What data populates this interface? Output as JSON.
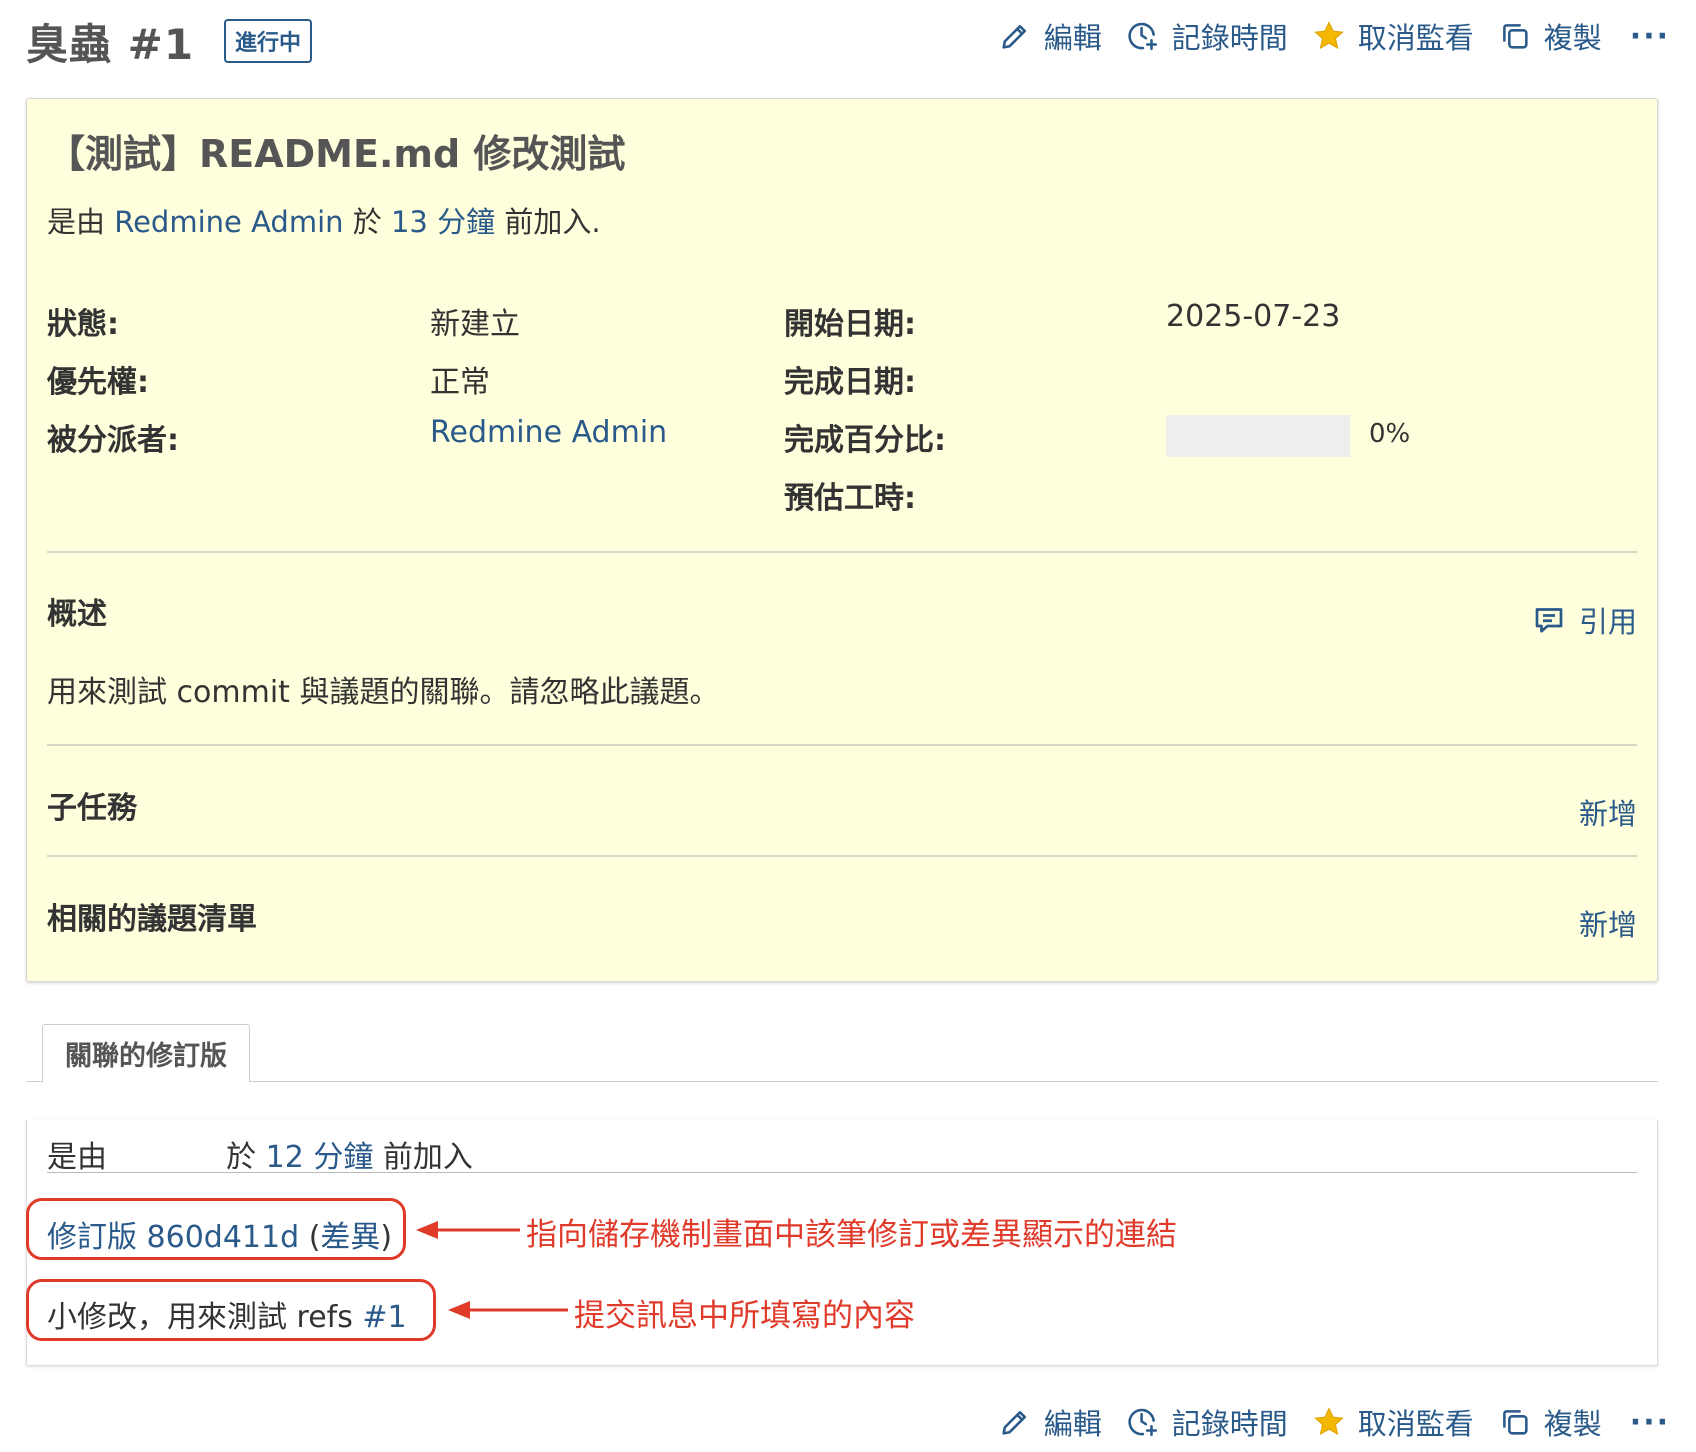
{
  "header": {
    "title": "臭蟲 #1",
    "status_badge": "進行中"
  },
  "actions": {
    "edit": "編輯",
    "log_time": "記錄時間",
    "unwatch": "取消監看",
    "copy": "複製",
    "more": "···"
  },
  "issue": {
    "subject": "【測試】README.md 修改測試",
    "author": {
      "prefix": "是由",
      "user": "Redmine Admin",
      "mid": "於",
      "time": "13 分鐘",
      "suffix": "前加入."
    },
    "attributes": {
      "status_label": "狀態:",
      "status_value": "新建立",
      "priority_label": "優先權:",
      "priority_value": "正常",
      "assignee_label": "被分派者:",
      "assignee_value": "Redmine Admin",
      "start_date_label": "開始日期:",
      "start_date_value": "2025-07-23",
      "due_date_label": "完成日期:",
      "done_ratio_label": "完成百分比:",
      "done_ratio_value": "0%",
      "done_ratio": 0,
      "estimated_hours_label": "預估工時:"
    },
    "description": {
      "title": "概述",
      "quote": "引用",
      "text": "用來測試 commit 與議題的關聯。請忽略此議題。"
    },
    "subtasks": {
      "title": "子任務",
      "add": "新增"
    },
    "relations": {
      "title": "相關的議題清單",
      "add": "新增"
    }
  },
  "tabs": {
    "revisions": "關聯的修訂版"
  },
  "revision": {
    "head_prefix": "是由",
    "head_mid": "於",
    "head_time": "12 分鐘",
    "head_suffix": "前加入",
    "rev_label": "修訂版 860d411d",
    "diff_open": "(",
    "diff_label": "差異",
    "diff_close": ")",
    "message_text": "小修改，用來測試 refs",
    "message_ref": "#1"
  },
  "annotations": {
    "link_note": "指向儲存機制畫面中該筆修訂或差異顯示的連結",
    "message_note": "提交訊息中所填寫的內容",
    "color": "#e03a2a"
  },
  "colors": {
    "link": "#2a5a8a",
    "issue_bg": "#ffffdd",
    "star": "#f5b800"
  }
}
